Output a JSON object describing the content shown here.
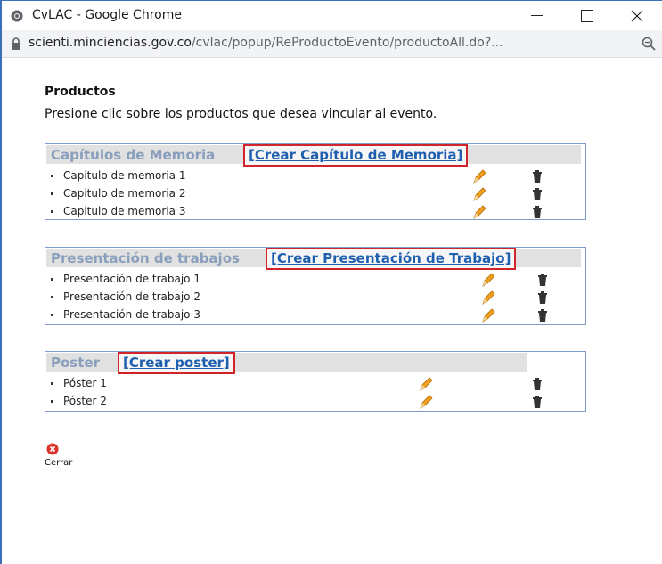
{
  "window": {
    "title": "CvLAC - Google Chrome",
    "url_host": "scienti.minciencias.gov.co",
    "url_path": "/cvlac/popup/ReProductoEvento/productoAll.do?..."
  },
  "page": {
    "heading": "Productos",
    "instruction": "Presione clic sobre los productos que desea vincular al evento."
  },
  "sections": [
    {
      "title": "Capítulos de Memoria",
      "create_label": "[Crear Capítulo de Memoria]",
      "items": [
        "Capitulo de memoria 1",
        "Capitulo de memoria 2",
        "Capitulo de memoria 3"
      ]
    },
    {
      "title": "Presentación de trabajos",
      "create_label": "[Crear Presentación de Trabajo]",
      "items": [
        "Presentación de trabajo 1",
        "Presentación de trabajo 2",
        "Presentación de trabajo 3"
      ]
    },
    {
      "title": "Poster",
      "create_label": "[Crear poster]",
      "items": [
        "Póster 1",
        "Póster 2"
      ]
    }
  ],
  "close": {
    "label": "Cerrar"
  },
  "colors": {
    "section_border": "#7a9cc6",
    "section_title": "#8a9fbc",
    "link": "#1f5fb0",
    "highlight": "#d0232a",
    "close_icon": "#d9342b"
  },
  "icons": {
    "edit": "pencil-icon",
    "delete": "trash-icon",
    "close": "close-circle-icon"
  }
}
